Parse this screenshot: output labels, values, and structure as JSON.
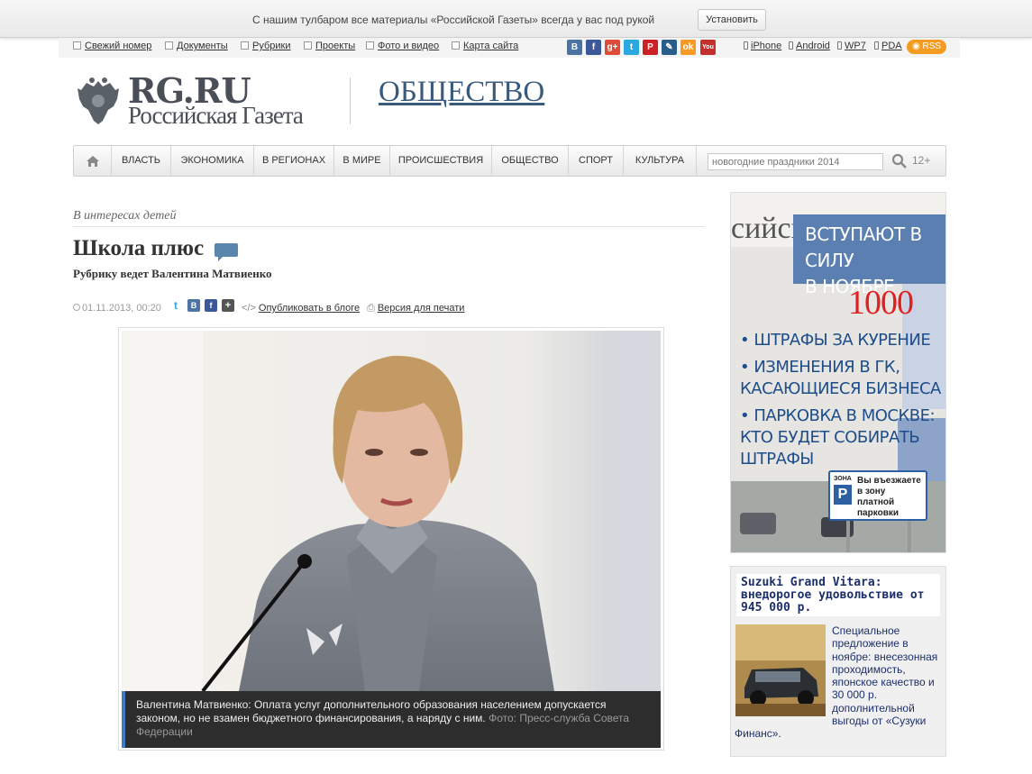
{
  "toolbar_prompt": {
    "text": "С нашим тулбаром все материалы «Российской Газеты» всегда у вас под рукой",
    "install_label": "Установить"
  },
  "top_links": [
    "Свежий номер",
    "Документы",
    "Рубрики",
    "Проекты",
    "Фото и видео",
    "Карта сайта"
  ],
  "social": [
    {
      "name": "vk-icon",
      "glyph": "В",
      "color": "#4b73a4"
    },
    {
      "name": "facebook-icon",
      "glyph": "f",
      "color": "#3b5998"
    },
    {
      "name": "google-plus-icon",
      "glyph": "g+",
      "color": "#dd4b39"
    },
    {
      "name": "twitter-icon",
      "glyph": "t",
      "color": "#2aa9e0"
    },
    {
      "name": "pinterest-icon",
      "glyph": "P",
      "color": "#cb2027"
    },
    {
      "name": "livejournal-icon",
      "glyph": "✎",
      "color": "#2b5d8a"
    },
    {
      "name": "odnoklassniki-icon",
      "glyph": "ok",
      "color": "#f59a23"
    },
    {
      "name": "mailru-icon",
      "glyph": "@",
      "color": "#168de2"
    },
    {
      "name": "youtube-icon",
      "glyph": "You",
      "color": "#c4302b"
    }
  ],
  "mobile_links": [
    "iPhone",
    "Android",
    "WP7",
    "PDA"
  ],
  "rss_label": "RSS",
  "logo": {
    "main": "RG.RU",
    "sub": "Российская Газета"
  },
  "section_title": "ОБЩЕСТВО",
  "nav": {
    "items": [
      "ВЛАСТЬ",
      "ЭКОНОМИКА",
      "В РЕГИОНАХ",
      "В МИРЕ",
      "ПРОИСШЕСТВИЯ",
      "ОБЩЕСТВО",
      "СПОРТ",
      "КУЛЬТУРА"
    ],
    "search_placeholder": "новогодние праздники 2014",
    "age_rating": "12+"
  },
  "article": {
    "kicker": "В интересах детей",
    "title": "Школа плюс",
    "subtitle": "Рубрику ведет Валентина Матвиенко",
    "date": "01.11.2013, 00:20",
    "publish_blog": "Опубликовать в блоге",
    "print_version": "Версия для печати",
    "caption": "Валентина Матвиенко: Оплата услуг дополнительного образования населением допускается законом, но не взамен бюджетного финансирования, а наряду с ним.",
    "photo_credit": "Фото: Пресс-служба Совета Федерации"
  },
  "promo": {
    "headline": [
      "ВСТУПАЮТ В СИЛУ",
      "В НОЯБРЕ"
    ],
    "number": "1000",
    "items": [
      "• ШТРАФЫ ЗА КУРЕНИЕ",
      "• ИЗМЕНЕНИЯ В ГК, КАСАЮЩИЕСЯ БИЗНЕСА",
      "• ПАРКОВКА В МОСКВЕ: КТО БУДЕТ СОБИРАТЬ ШТРАФЫ"
    ],
    "sign_zone": "ЗОНА",
    "sign_text": "Вы въезжаете в зону платной парковки"
  },
  "ad": {
    "title": "Suzuki Grand Vitara: внедорогое удовольствие от 945 000 р.",
    "text": "Специальное предложение в ноябре: внесезонная проходимость, японское качество и 30 000 р. дополнительной выгоды от «Сузуки Финанс»."
  }
}
